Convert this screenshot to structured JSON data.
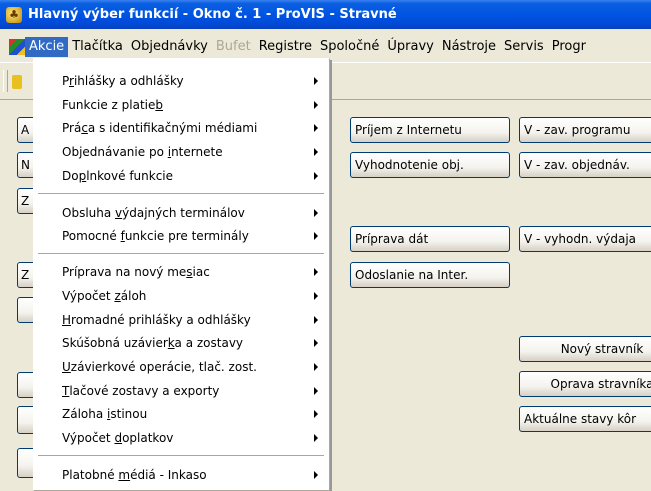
{
  "window": {
    "title": "Hlavný výber funkcií - Okno č. 1 - ProVIS - Stravné"
  },
  "menubar": {
    "items": [
      {
        "label": "Akcie",
        "state": "active"
      },
      {
        "label": "Tlačítka",
        "state": "normal"
      },
      {
        "label": "Objednávky",
        "state": "normal"
      },
      {
        "label": "Bufet",
        "state": "disabled"
      },
      {
        "label": "Registre",
        "state": "normal"
      },
      {
        "label": "Spoločné",
        "state": "normal"
      },
      {
        "label": "Úpravy",
        "state": "normal"
      },
      {
        "label": "Nástroje",
        "state": "normal"
      },
      {
        "label": "Servis",
        "state": "normal"
      },
      {
        "label": "Progr",
        "state": "normal"
      }
    ]
  },
  "akcie_menu": {
    "items": [
      {
        "pre": "P",
        "u": "r",
        "post": "ihlášky a odhlášky"
      },
      {
        "pre": "Funkcie z platie",
        "u": "b",
        "post": ""
      },
      {
        "pre": "Prá",
        "u": "c",
        "post": "a s identifikačnými médiami"
      },
      {
        "pre": "Objednávanie po ",
        "u": "i",
        "post": "nternete"
      },
      {
        "pre": "Do",
        "u": "p",
        "post": "lnkové funkcie"
      },
      {
        "pre": "Obsluha ",
        "u": "v",
        "post": "ýdajných terminálov"
      },
      {
        "pre": "Pomocné ",
        "u": "f",
        "post": "unkcie pre terminály"
      },
      {
        "pre": "Príprava na nový me",
        "u": "s",
        "post": "iac"
      },
      {
        "pre": "Výpočet ",
        "u": "z",
        "post": "áloh"
      },
      {
        "pre": "",
        "u": "H",
        "post": "romadné prihlášky a odhlášky"
      },
      {
        "pre": "Skúšobná uzávier",
        "u": "k",
        "post": "a a zostavy"
      },
      {
        "pre": "",
        "u": "U",
        "post": "závierkové operácie, tlač. zost."
      },
      {
        "pre": "",
        "u": "T",
        "post": "lačové zostavy a exporty"
      },
      {
        "pre": "Záloha ",
        "u": "i",
        "post": "stinou"
      },
      {
        "pre": "Výpočet ",
        "u": "d",
        "post": "oplatkov"
      },
      {
        "pre": "Platobné ",
        "u": "m",
        "post": "édiá - Inkaso"
      }
    ]
  },
  "buttons": {
    "prijem": "Príjem z Internetu",
    "vyhodnotenie": "Vyhodnotenie obj.",
    "priprava": "Príprava dát",
    "odoslanie": "Odoslanie na Inter.",
    "v_zav_programu": "V - zav. programu",
    "v_zav_objednav": "V - zav. objednáv.",
    "v_vyhodn": "V - vyhodn. výdaja",
    "novy": "Nový stravník",
    "oprava": "Oprava stravníka",
    "aktualne": "Aktuálne stavy kôr",
    "left": [
      "A",
      "N",
      "Z",
      "Z"
    ]
  }
}
